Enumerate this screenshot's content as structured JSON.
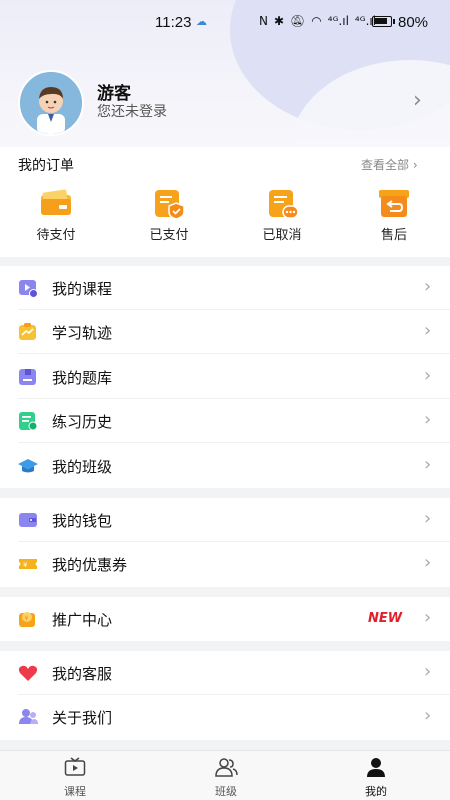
{
  "status_bar": {
    "time": "11:23",
    "battery": "80%",
    "net1": "⁴ᴳ.ıl",
    "net2": "⁴ᴳ.ıl"
  },
  "profile": {
    "name": "游客",
    "subtitle": "您还未登录"
  },
  "orders": {
    "title": "我的订单",
    "view_all": "查看全部",
    "items": [
      {
        "label": "待支付",
        "icon": "wallet-icon"
      },
      {
        "label": "已支付",
        "icon": "paid-doc-icon"
      },
      {
        "label": "已取消",
        "icon": "cancelled-doc-icon"
      },
      {
        "label": "售后",
        "icon": "return-box-icon"
      }
    ]
  },
  "menu": {
    "group1": [
      {
        "label": "我的课程",
        "icon": "video-course-icon"
      },
      {
        "label": "学习轨迹",
        "icon": "trend-icon"
      },
      {
        "label": "我的题库",
        "icon": "question-bank-icon"
      },
      {
        "label": "练习历史",
        "icon": "practice-history-icon"
      },
      {
        "label": "我的班级",
        "icon": "graduation-cap-icon"
      }
    ],
    "group2": [
      {
        "label": "我的钱包",
        "icon": "wallet-icon"
      },
      {
        "label": "我的优惠券",
        "icon": "coupon-icon"
      }
    ],
    "group3": [
      {
        "label": "推广中心",
        "icon": "promotion-icon",
        "badge": "NEW"
      }
    ],
    "group4": [
      {
        "label": "我的客服",
        "icon": "heart-icon"
      },
      {
        "label": "关于我们",
        "icon": "about-us-icon"
      }
    ]
  },
  "tabbar": [
    {
      "label": "课程",
      "icon": "tv-icon"
    },
    {
      "label": "班级",
      "icon": "class-icon"
    },
    {
      "label": "我的",
      "icon": "user-icon"
    }
  ],
  "colors": {
    "accent_orange": "#f7a21b",
    "new_badge": "#e0202a",
    "purple": "#7b72e8"
  }
}
